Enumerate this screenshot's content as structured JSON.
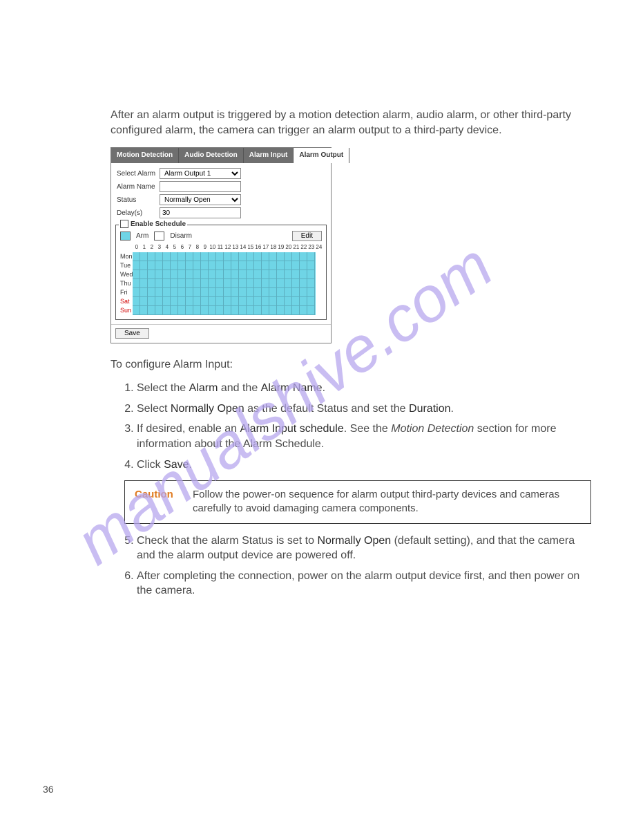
{
  "pageNumber": "36",
  "intro": "After an alarm output is triggered by a motion detection alarm, audio alarm, or other third-party configured alarm, the camera can trigger an alarm output to a third-party device.",
  "watermark": "manualshive.com",
  "screenshot": {
    "tabs": [
      "Motion Detection",
      "Audio Detection",
      "Alarm Input",
      "Alarm Output"
    ],
    "activeTab": 3,
    "fields": {
      "selectAlarmLabel": "Select Alarm",
      "selectAlarmValue": "Alarm Output 1",
      "alarmNameLabel": "Alarm Name",
      "alarmNameValue": "",
      "statusLabel": "Status",
      "statusValue": "Normally Open",
      "delayLabel": "Delay(s)",
      "delayValue": "30"
    },
    "scheduleLegend": "Enable Schedule",
    "armLabel": "Arm",
    "disarmLabel": "Disarm",
    "editLabel": "Edit",
    "saveLabel": "Save",
    "days": [
      "Mon",
      "Tue",
      "Wed",
      "Thu",
      "Fri",
      "Sat",
      "Sun"
    ],
    "weekendIdx": [
      5,
      6
    ],
    "hours": [
      "0",
      "1",
      "2",
      "3",
      "4",
      "5",
      "6",
      "7",
      "8",
      "9",
      "10",
      "11",
      "12",
      "13",
      "14",
      "15",
      "16",
      "17",
      "18",
      "19",
      "20",
      "21",
      "22",
      "23",
      "24"
    ]
  },
  "sectionLead": "To configure Alarm Input:",
  "steps": [
    {
      "pre": "Select the ",
      "b1": "Alarm",
      "mid": " and the ",
      "b2": "Alarm Name",
      "post": "."
    },
    {
      "pre": "Select ",
      "b1": "Normally Open",
      "mid": " as the default Status and set the ",
      "b2": "Duration",
      "post": "."
    },
    {
      "pre": "If desired, enable an ",
      "b1": "Alarm Input schedule",
      "mid": ". See the ",
      "it": "Motion Detection",
      "post": " section for more information about the Alarm Schedule."
    },
    {
      "pre": "Click ",
      "b1": "Save",
      "post": "."
    }
  ],
  "caution": {
    "label": "Caution",
    "text": "Follow the power-on sequence for alarm output third-party devices and cameras carefully to avoid damaging camera components."
  },
  "steps2": [
    {
      "pre": "Check that the alarm Status is set to ",
      "b1": "Normally Open",
      "post": " (default setting), and that the camera and the alarm output device are powered off."
    },
    {
      "pre": "After completing the connection, power on the alarm output device first, and then power on the camera.",
      "b1": "",
      "post": ""
    }
  ]
}
